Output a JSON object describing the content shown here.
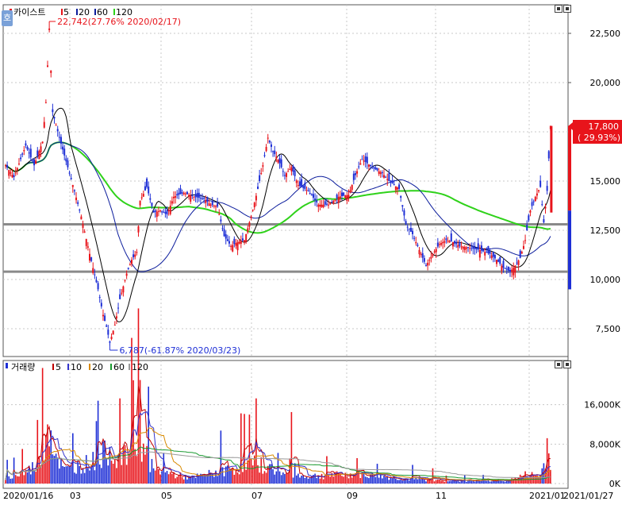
{
  "colors": {
    "up": "#e8141b",
    "down": "#1e2fd6",
    "ma5": "#000000",
    "ma20": "#0b1c9c",
    "ma60": "#2fd21a",
    "grid": "#c8c8c8",
    "support": "#8a8a8a",
    "vol_ma5": "#c00000",
    "vol_ma10": "#3333cc",
    "vol_ma20": "#d88a00",
    "vol_ma60": "#1a9a30",
    "vol_ma120": "#999999"
  },
  "side_tab_label": "호",
  "price_legend": {
    "title": "카이스트",
    "items": [
      "5",
      "20",
      "60",
      "120"
    ]
  },
  "volume_legend": {
    "title": "거래량",
    "items": [
      "5",
      "10",
      "20",
      "60",
      "120"
    ]
  },
  "annotations": {
    "high": "22,742(27.76% 2020/02/17)",
    "low": "6,787(-61.87% 2020/03/23)",
    "last_price": "17,800",
    "last_change": "( 29.93%)"
  },
  "x_labels": [
    "2020/01/16",
    "03",
    "05",
    "07",
    "09",
    "11",
    "2021/01",
    "2021/01/27"
  ],
  "chart_data": [
    {
      "type": "candlestick",
      "name": "price",
      "y_ticks": [
        "22,500",
        "20,000",
        "17,500",
        "15,000",
        "12,500",
        "10,000",
        "7,500"
      ],
      "support_levels": [
        12800,
        10400
      ],
      "last": 17800,
      "high_point": {
        "value": 22742,
        "date": "2020/02/17"
      },
      "low_point": {
        "value": 6787,
        "date": "2020/03/23"
      },
      "keypoints": [
        [
          0,
          15800
        ],
        [
          5,
          15200
        ],
        [
          12,
          16800
        ],
        [
          17,
          15800
        ],
        [
          22,
          17000
        ],
        [
          24,
          19000
        ],
        [
          26,
          22742
        ],
        [
          28,
          18500
        ],
        [
          32,
          17200
        ],
        [
          36,
          16000
        ],
        [
          40,
          14800
        ],
        [
          45,
          13200
        ],
        [
          50,
          11300
        ],
        [
          55,
          9500
        ],
        [
          58,
          8200
        ],
        [
          60,
          7600
        ],
        [
          62,
          6787
        ],
        [
          65,
          7700
        ],
        [
          68,
          9000
        ],
        [
          72,
          10300
        ],
        [
          75,
          11000
        ],
        [
          78,
          11400
        ],
        [
          80,
          14000
        ],
        [
          84,
          14700
        ],
        [
          88,
          13400
        ],
        [
          92,
          13500
        ],
        [
          96,
          13300
        ],
        [
          100,
          14200
        ],
        [
          106,
          14400
        ],
        [
          112,
          14200
        ],
        [
          118,
          14100
        ],
        [
          122,
          13800
        ],
        [
          126,
          13700
        ],
        [
          130,
          12200
        ],
        [
          134,
          11700
        ],
        [
          138,
          11900
        ],
        [
          142,
          12000
        ],
        [
          146,
          13200
        ],
        [
          150,
          14600
        ],
        [
          153,
          15800
        ],
        [
          156,
          17200
        ],
        [
          159,
          16500
        ],
        [
          162,
          16100
        ],
        [
          166,
          15300
        ],
        [
          170,
          15700
        ],
        [
          174,
          14800
        ],
        [
          180,
          14500
        ],
        [
          186,
          13800
        ],
        [
          192,
          13800
        ],
        [
          198,
          14200
        ],
        [
          204,
          14300
        ],
        [
          208,
          15300
        ],
        [
          212,
          16100
        ],
        [
          218,
          15700
        ],
        [
          224,
          15400
        ],
        [
          228,
          15000
        ],
        [
          234,
          14600
        ],
        [
          238,
          12800
        ],
        [
          242,
          12300
        ],
        [
          246,
          11500
        ],
        [
          250,
          10700
        ],
        [
          254,
          11300
        ],
        [
          258,
          11800
        ],
        [
          262,
          12000
        ],
        [
          266,
          11900
        ],
        [
          270,
          11700
        ],
        [
          276,
          11600
        ],
        [
          282,
          11500
        ],
        [
          288,
          11300
        ],
        [
          292,
          11000
        ],
        [
          296,
          10600
        ],
        [
          300,
          10400
        ],
        [
          303,
          10700
        ],
        [
          306,
          11100
        ],
        [
          309,
          12000
        ],
        [
          312,
          13500
        ],
        [
          315,
          14200
        ],
        [
          318,
          14700
        ],
        [
          320,
          12900
        ],
        [
          322,
          14500
        ],
        [
          324,
          17800
        ]
      ],
      "volume_keypoints": [
        [
          0,
          1500
        ],
        [
          10,
          2500
        ],
        [
          20,
          5500
        ],
        [
          26,
          17000
        ],
        [
          29,
          9000
        ],
        [
          35,
          3500
        ],
        [
          45,
          5000
        ],
        [
          55,
          6500
        ],
        [
          62,
          9500
        ],
        [
          68,
          6000
        ],
        [
          75,
          9000
        ],
        [
          80,
          12000
        ],
        [
          88,
          3500
        ],
        [
          100,
          2500
        ],
        [
          110,
          1500
        ],
        [
          130,
          3500
        ],
        [
          150,
          5500
        ],
        [
          165,
          2500
        ],
        [
          180,
          2000
        ],
        [
          210,
          2500
        ],
        [
          240,
          1200
        ],
        [
          270,
          700
        ],
        [
          300,
          900
        ],
        [
          310,
          2500
        ],
        [
          318,
          2000
        ],
        [
          322,
          8500
        ],
        [
          324,
          5500
        ]
      ]
    },
    {
      "type": "bar",
      "name": "volume",
      "y_ticks": [
        "16,000K",
        "8,000K",
        "0K"
      ]
    }
  ]
}
